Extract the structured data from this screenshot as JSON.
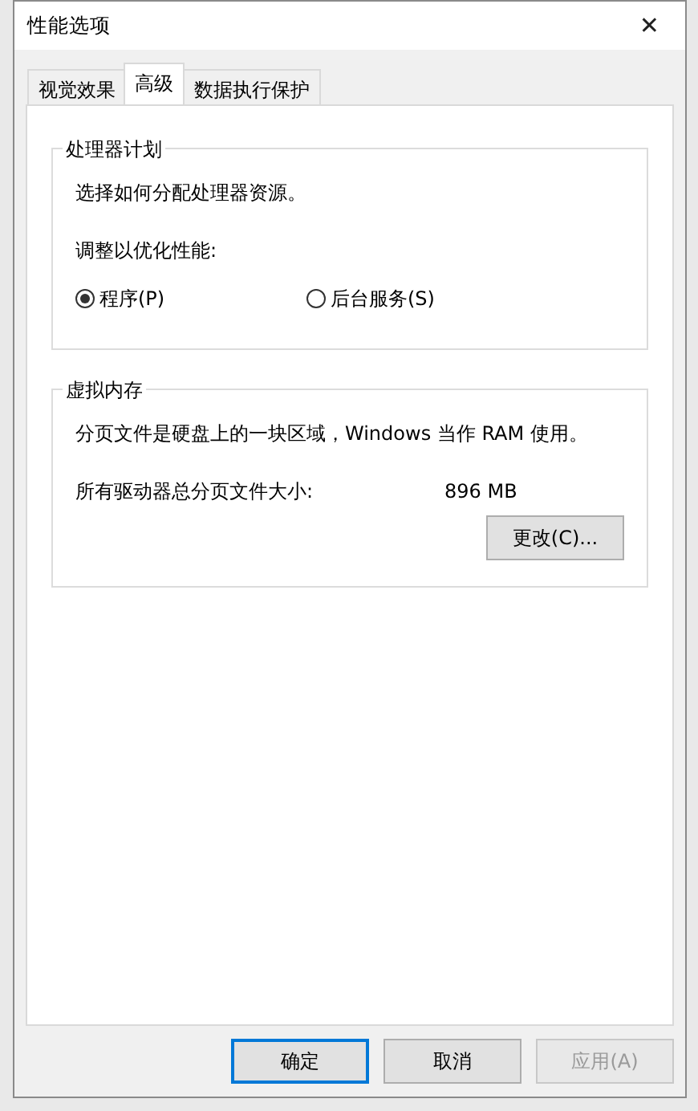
{
  "window": {
    "title": "性能选项",
    "close": "✕"
  },
  "tabs": [
    {
      "label": "视觉效果",
      "selected": false
    },
    {
      "label": "高级",
      "selected": true
    },
    {
      "label": "数据执行保护",
      "selected": false
    }
  ],
  "processor_scheduling": {
    "title": "处理器计划",
    "description": "选择如何分配处理器资源。",
    "prompt": "调整以优化性能:",
    "options": [
      {
        "label": "程序(P)",
        "selected": true
      },
      {
        "label": "后台服务(S)",
        "selected": false
      }
    ]
  },
  "virtual_memory": {
    "title": "虚拟内存",
    "description": "分页文件是硬盘上的一块区域，Windows 当作 RAM 使用。",
    "total_label": "所有驱动器总分页文件大小:",
    "total_value": "896 MB",
    "button": "更改(C)..."
  },
  "buttons": [
    {
      "label": "确定",
      "default": true,
      "disabled": false
    },
    {
      "label": "取消",
      "default": false,
      "disabled": false
    },
    {
      "label": "应用(A)",
      "default": false,
      "disabled": true
    }
  ]
}
